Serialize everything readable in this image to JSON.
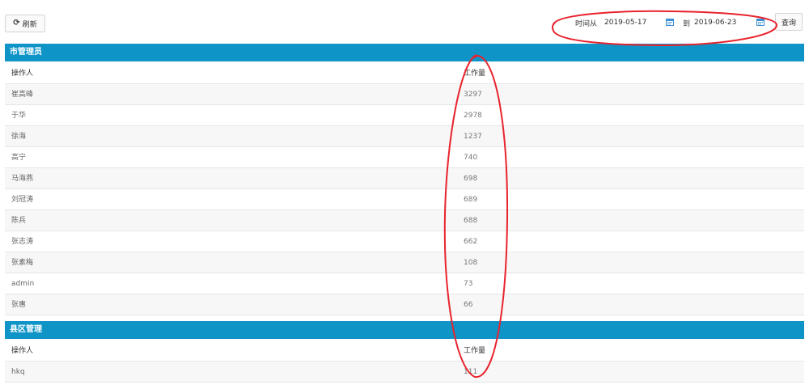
{
  "toolbar": {
    "refresh_label": "刷新",
    "time_from_label": "时间从",
    "date_from": "2019-05-17",
    "to_label": "到",
    "date_to": "2019-06-23",
    "query_label": "查询"
  },
  "sections": [
    {
      "title": "市管理员",
      "columns": [
        "操作人",
        "工作量"
      ],
      "rows": [
        {
          "name": "崔高峰",
          "count": "3297"
        },
        {
          "name": "于华",
          "count": "2978"
        },
        {
          "name": "徐海",
          "count": "1237"
        },
        {
          "name": "高宁",
          "count": "740"
        },
        {
          "name": "马海燕",
          "count": "698"
        },
        {
          "name": "刘冠涛",
          "count": "689"
        },
        {
          "name": "陈兵",
          "count": "688"
        },
        {
          "name": "张志涛",
          "count": "662"
        },
        {
          "name": "张素梅",
          "count": "108"
        },
        {
          "name": "admin",
          "count": "73"
        },
        {
          "name": "张惠",
          "count": "66"
        }
      ]
    },
    {
      "title": "县区管理",
      "columns": [
        "操作人",
        "工作量"
      ],
      "rows": [
        {
          "name": "hkq",
          "count": "111"
        }
      ]
    }
  ],
  "colors": {
    "section_header": "#0f94c8",
    "annotation": "#e8232d",
    "calendar_icon": "#3a8fd6"
  },
  "icons": {
    "refresh": "refresh-icon",
    "calendar": "calendar-icon"
  }
}
